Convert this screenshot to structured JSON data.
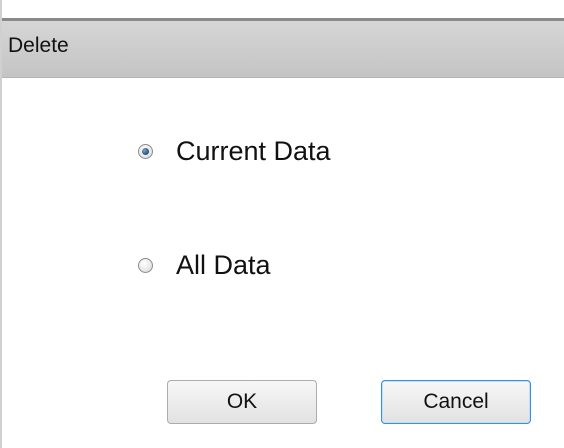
{
  "dialog": {
    "title": "Delete",
    "options": [
      {
        "label": "Current Data",
        "selected": true
      },
      {
        "label": "All Data",
        "selected": false
      }
    ],
    "buttons": {
      "ok_label": "OK",
      "cancel_label": "Cancel"
    },
    "colors": {
      "titlebar": "#c8c8c8",
      "focus_border": "#3c8fd6",
      "radio_dot": "#2b5a86"
    }
  }
}
